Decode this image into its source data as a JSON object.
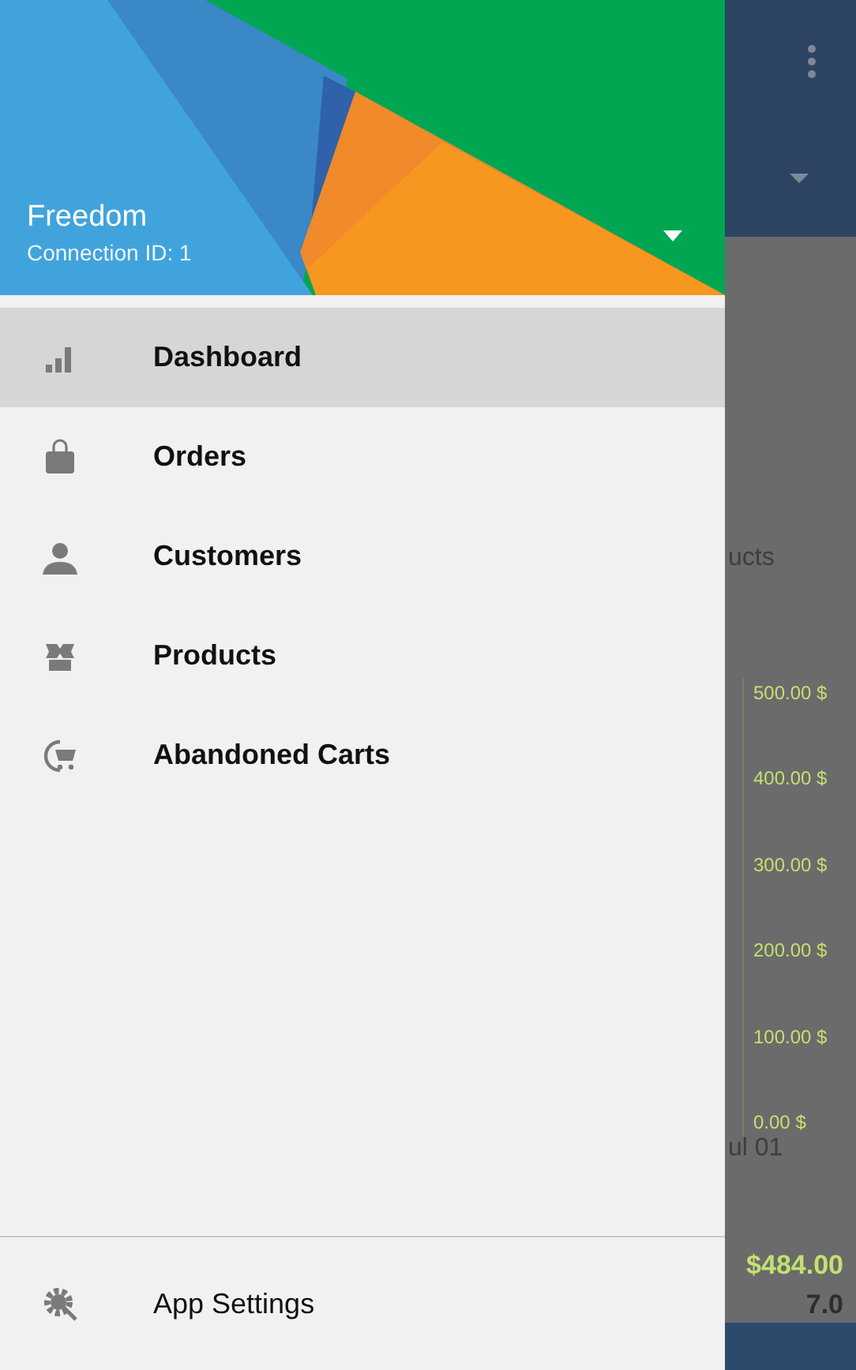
{
  "header": {
    "title": "Freedom",
    "subtitle": "Connection ID: 1"
  },
  "menu": [
    {
      "label": "Dashboard",
      "kind": "chart",
      "selected": true
    },
    {
      "label": "Orders",
      "kind": "bag",
      "selected": false
    },
    {
      "label": "Customers",
      "kind": "person",
      "selected": false
    },
    {
      "label": "Products",
      "kind": "boxes",
      "selected": false
    },
    {
      "label": "Abandoned Carts",
      "kind": "cart",
      "selected": false
    }
  ],
  "footer_menu": [
    {
      "label": "App Settings",
      "kind": "gear",
      "selected": false
    }
  ],
  "background": {
    "heading_fragment": "ucts",
    "y_axis_labels": [
      "500.00 $",
      "400.00 $",
      "300.00 $",
      "200.00 $",
      "100.00 $",
      "0.00 $"
    ],
    "x_label_fragment": "ul 01",
    "total": "$484.00",
    "count": "7.0"
  }
}
